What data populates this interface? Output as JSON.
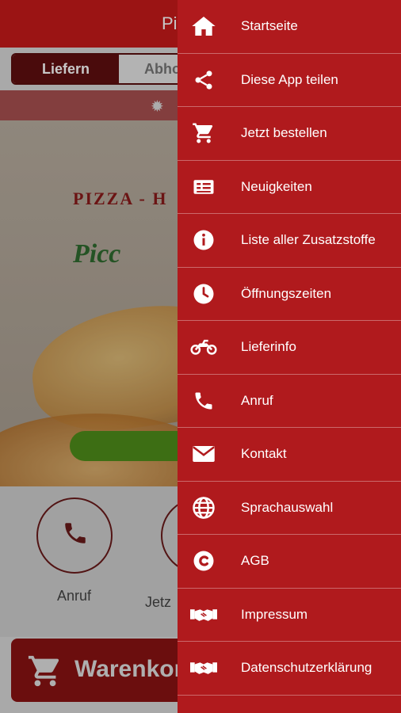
{
  "app": {
    "title": "Pi"
  },
  "order_mode": {
    "deliver_label": "Liefern",
    "pickup_label": "Abho"
  },
  "hero": {
    "logo_line1": "PIZZA - H",
    "logo_line2": "Picc"
  },
  "quick_actions": [
    {
      "label": "Anruf",
      "icon": "phone-icon"
    },
    {
      "label": "Jetz",
      "icon": "cart-icon"
    }
  ],
  "cart_button": {
    "label": "Warenkorl"
  },
  "drawer": {
    "items": [
      {
        "label": "Startseite",
        "icon": "home-icon"
      },
      {
        "label": "Diese App teilen",
        "icon": "share-icon"
      },
      {
        "label": "Jetzt bestellen",
        "icon": "cart-icon"
      },
      {
        "label": "Neuigkeiten",
        "icon": "news-icon"
      },
      {
        "label": "Liste aller Zusatzstoffe",
        "icon": "info-icon"
      },
      {
        "label": "Öffnungszeiten",
        "icon": "clock-icon"
      },
      {
        "label": "Lieferinfo",
        "icon": "motorcycle-icon"
      },
      {
        "label": "Anruf",
        "icon": "phone-icon"
      },
      {
        "label": "Kontakt",
        "icon": "mail-icon"
      },
      {
        "label": "Sprachauswahl",
        "icon": "globe-icon"
      },
      {
        "label": "AGB",
        "icon": "copyright-icon"
      },
      {
        "label": "Impressum",
        "icon": "handshake-icon"
      },
      {
        "label": "Datenschutzerklärung",
        "icon": "handshake-icon"
      }
    ]
  },
  "colors": {
    "brand_red": "#c71a1a",
    "drawer_red": "#b01a1d",
    "accent_green": "#4f8d1a"
  }
}
